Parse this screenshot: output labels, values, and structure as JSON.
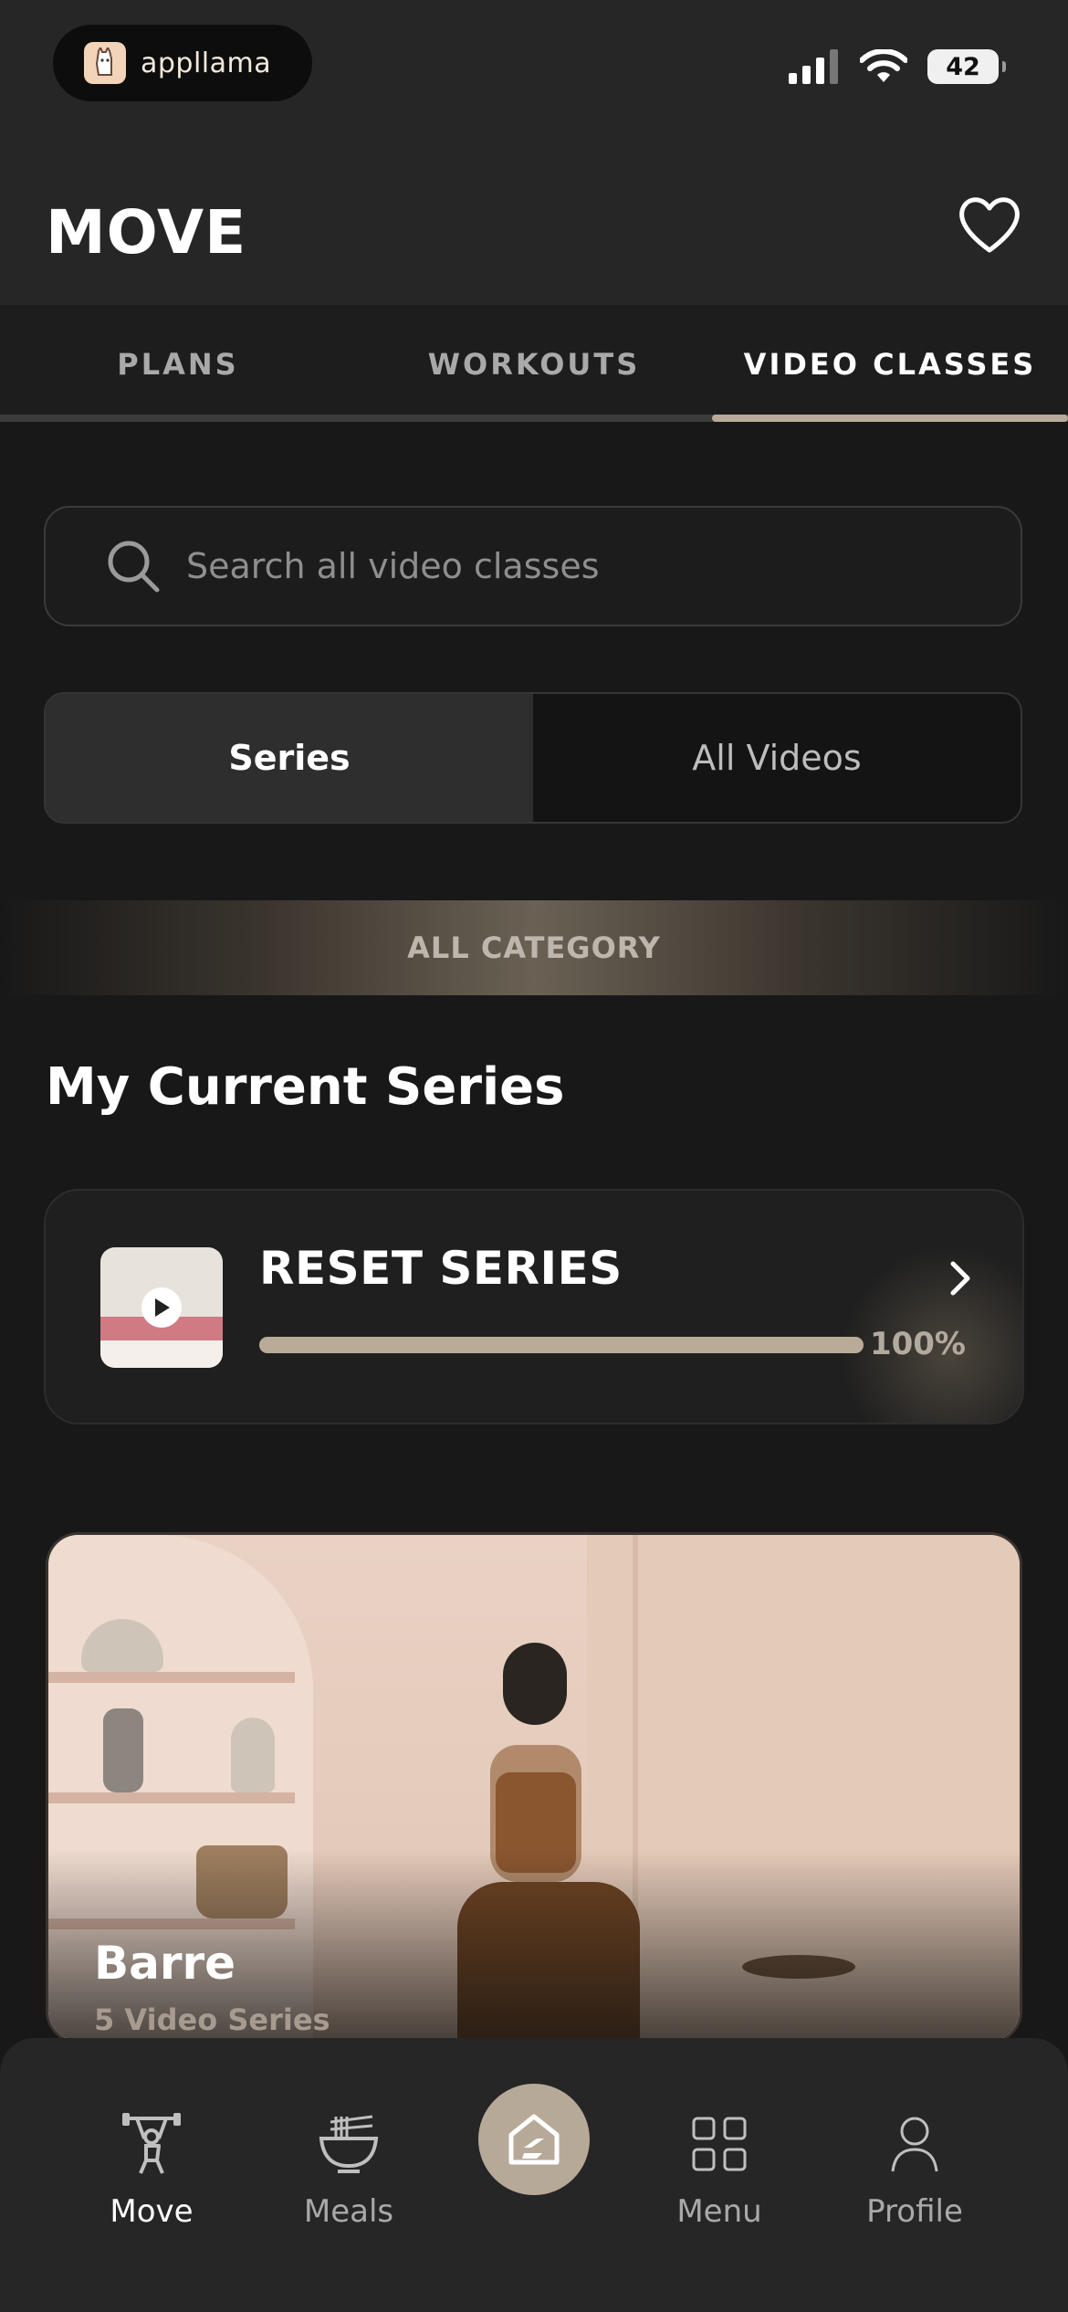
{
  "status": {
    "brand": "appllama",
    "battery": "42"
  },
  "header": {
    "title": "MOVE"
  },
  "tabs": [
    {
      "label": "PLANS",
      "active": false
    },
    {
      "label": "WORKOUTS",
      "active": false
    },
    {
      "label": "VIDEO CLASSES",
      "active": true
    }
  ],
  "search": {
    "placeholder": "Search all video classes",
    "value": ""
  },
  "segment": [
    {
      "label": "Series",
      "active": true
    },
    {
      "label": "All Videos",
      "active": false
    }
  ],
  "category": {
    "label": "ALL CATEGORY"
  },
  "current_series": {
    "heading": "My Current Series",
    "items": [
      {
        "name": "RESET SERIES",
        "progress": 1.0,
        "progress_label": "100%"
      }
    ]
  },
  "featured": [
    {
      "title": "Barre",
      "subtitle": "5 Video Series"
    }
  ],
  "nav": [
    {
      "label": "Move",
      "icon": "weightlifter-icon",
      "active": true
    },
    {
      "label": "Meals",
      "icon": "bowl-icon",
      "active": false
    },
    {
      "label": "",
      "icon": "home-logo-icon",
      "active": false
    },
    {
      "label": "Menu",
      "icon": "grid-icon",
      "active": false
    },
    {
      "label": "Profile",
      "icon": "person-icon",
      "active": false
    }
  ],
  "colors": {
    "accent": "#b9ab98",
    "background": "#181818",
    "surface": "#262626"
  }
}
